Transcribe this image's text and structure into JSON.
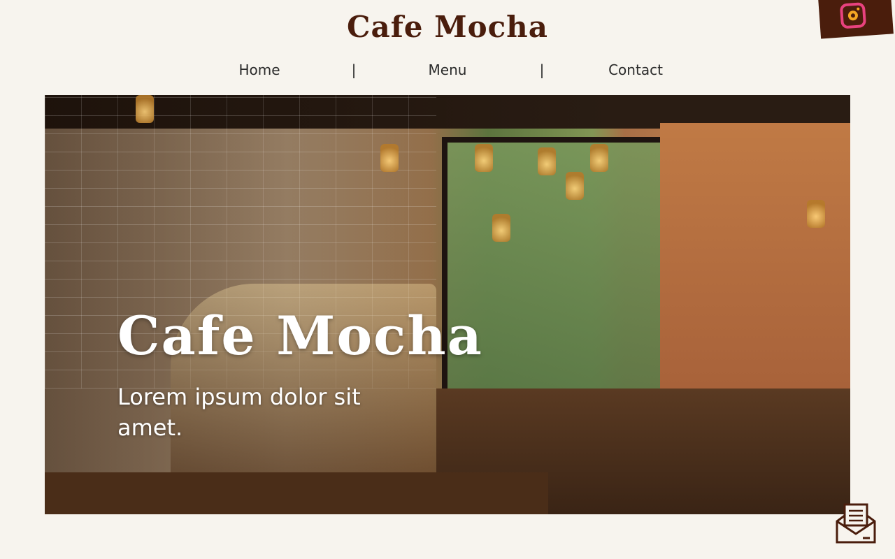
{
  "header": {
    "brand": "Cafe Mocha"
  },
  "social": {
    "instagram_icon": "instagram-icon"
  },
  "nav": {
    "items": [
      {
        "label": "Home"
      },
      {
        "label": "Menu"
      },
      {
        "label": "Contact"
      }
    ],
    "separator": "|"
  },
  "hero": {
    "title": "Cafe Mocha",
    "subtitle": "Lorem ipsum dolor sit amet."
  },
  "contact": {
    "mail_icon": "mail-icon"
  },
  "colors": {
    "background": "#f7f4ee",
    "brand": "#4a1d0c",
    "text": "#2a2a2a"
  }
}
